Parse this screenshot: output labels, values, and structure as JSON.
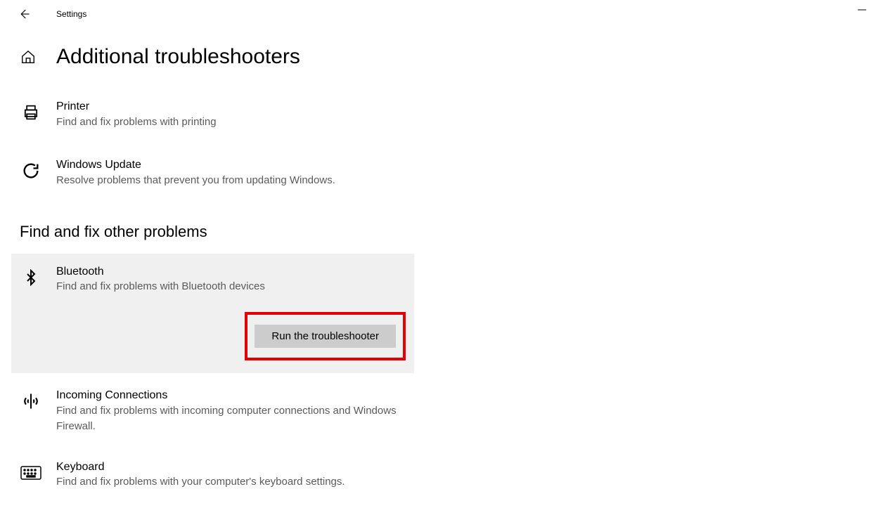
{
  "app": {
    "title": "Settings"
  },
  "page": {
    "title": "Additional troubleshooters"
  },
  "sectionA": {
    "printer": {
      "title": "Printer",
      "desc": "Find and fix problems with printing"
    },
    "windowsUpdate": {
      "title": "Windows Update",
      "desc": "Resolve problems that prevent you from updating Windows."
    }
  },
  "sectionBTitle": "Find and fix other problems",
  "sectionB": {
    "bluetooth": {
      "title": "Bluetooth",
      "desc": "Find and fix problems with Bluetooth devices",
      "runBtn": "Run the troubleshooter"
    },
    "incoming": {
      "title": "Incoming Connections",
      "desc": "Find and fix problems with incoming computer connections and Windows Firewall."
    },
    "keyboard": {
      "title": "Keyboard",
      "desc": "Find and fix problems with your computer's keyboard settings."
    }
  }
}
